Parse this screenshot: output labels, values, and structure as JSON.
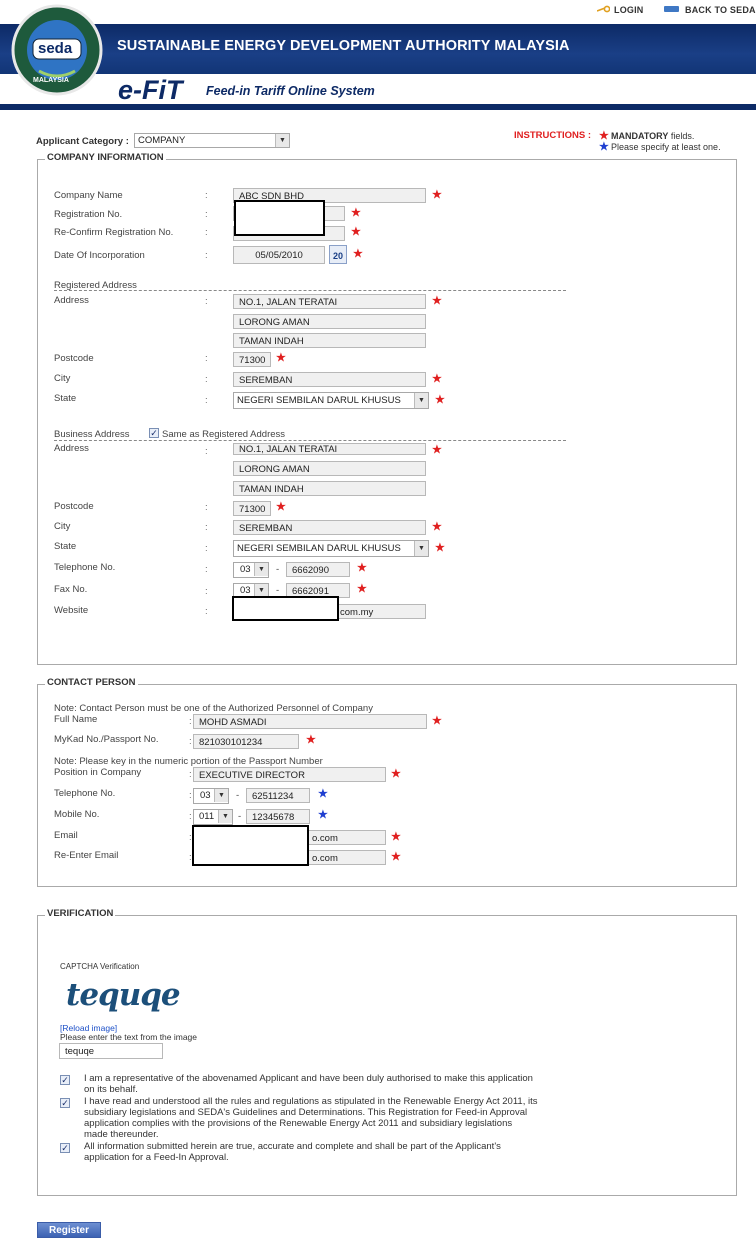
{
  "header": {
    "login_label": "LOGIN",
    "back_label": "BACK TO SEDA",
    "agency_title": "SUSTAINABLE ENERGY DEVELOPMENT AUTHORITY MALAYSIA",
    "logo_text": "seda",
    "logo_country": "MALAYSIA",
    "efit_label": "e-FiT",
    "efit_sub": "Feed-in Tariff Online System"
  },
  "applicant": {
    "category_label": "Applicant Category :",
    "category_value": "COMPANY"
  },
  "instructions": {
    "label": "INSTRUCTIONS :",
    "mandatory_bold": "MANDATORY",
    "mandatory_rest": " fields.",
    "at_least_one": "Please specify at least one."
  },
  "company": {
    "legend": "COMPANY INFORMATION",
    "name_label": "Company Name",
    "name_value": "ABC SDN BHD",
    "reg_label": "Registration No.",
    "reconfirm_label": "Re-Confirm Registration No.",
    "doi_label": "Date Of Incorporation",
    "doi_value": "05/05/2010",
    "calendar_text": "20",
    "registered_heading": "Registered Address",
    "address_label": "Address",
    "addr1": "NO.1, JALAN TERATAI",
    "addr2": "LORONG AMAN",
    "addr3": "TAMAN INDAH",
    "postcode_label": "Postcode",
    "postcode": "71300",
    "city_label": "City",
    "city": "SEREMBAN",
    "state_label": "State",
    "state": "NEGERI SEMBILAN DARUL KHUSUS",
    "business_heading": "Business Address",
    "same_as_label": "Same as Registered Address",
    "b_address_label": "Address",
    "b_addr1": "NO.1, JALAN TERATAI",
    "b_addr2": "LORONG AMAN",
    "b_addr3": "TAMAN INDAH",
    "b_postcode_label": "Postcode",
    "b_postcode": "71300",
    "b_city_label": "City",
    "b_city": "SEREMBAN",
    "b_state_label": "State",
    "b_state": "NEGERI SEMBILAN DARUL KHUSUS",
    "tel_label": "Telephone No.",
    "tel_prefix": "03",
    "tel_number": "6662090",
    "fax_label": "Fax No.",
    "fax_prefix": "03",
    "fax_number": "6662091",
    "website_label": "Website",
    "website_suffix": "com.my",
    "dash": "-",
    "colon": ":"
  },
  "contact": {
    "legend": "CONTACT PERSON",
    "note1": "Note: Contact Person must be one of the Authorized Personnel of Company",
    "fullname_label": "Full Name",
    "fullname": "MOHD ASMADI",
    "mykad_label": "MyKad No./Passport No.",
    "mykad": "821030101234",
    "note2": "Note: Please key in the numeric portion of the Passport Number",
    "position_label": "Position in Company",
    "position": "EXECUTIVE DIRECTOR",
    "tel_label": "Telephone No.",
    "tel_prefix": "03",
    "tel_number": "62511234",
    "mobile_label": "Mobile No.",
    "mobile_prefix": "011",
    "mobile_number": "12345678",
    "email_label": "Email",
    "email_suffix": "o.com",
    "reemail_label": "Re-Enter Email",
    "reemail_suffix": "o.com"
  },
  "verification": {
    "legend": "VERIFICATION",
    "captcha_label": "CAPTCHA Verification",
    "captcha_text": "tequqe",
    "reload_label": "[Reload image]",
    "enter_label": "Please enter the text from the image",
    "captcha_value": "tequqe",
    "decl1a": "I am a representative of the abovenamed Applicant and have been duly authorised to make this application",
    "decl1b": "on its behalf.",
    "decl2a": "I have read and understood all the rules and regulations as stipulated in the Renewable Energy Act 2011, its",
    "decl2b": "subsidiary legislations and SEDA's Guidelines and Determinations. This Registration for Feed-in Approval",
    "decl2c": "application complies with the provisions of the Renewable Energy Act 2011 and subsidiary legislations",
    "decl2d": "made thereunder.",
    "decl3a": "All information submitted herein are true, accurate and complete and shall be part of the Applicant's",
    "decl3b": "application for a Feed-In Approval."
  },
  "actions": {
    "register_label": "Register"
  },
  "colors": {
    "brand_navy": "#0d2a66",
    "mandatory": "#e02020",
    "atleastone": "#1f3fd0"
  },
  "icons": [
    "key-icon",
    "monitor-icon",
    "calendar-icon",
    "chevron-down-icon",
    "checkbox-icon"
  ]
}
